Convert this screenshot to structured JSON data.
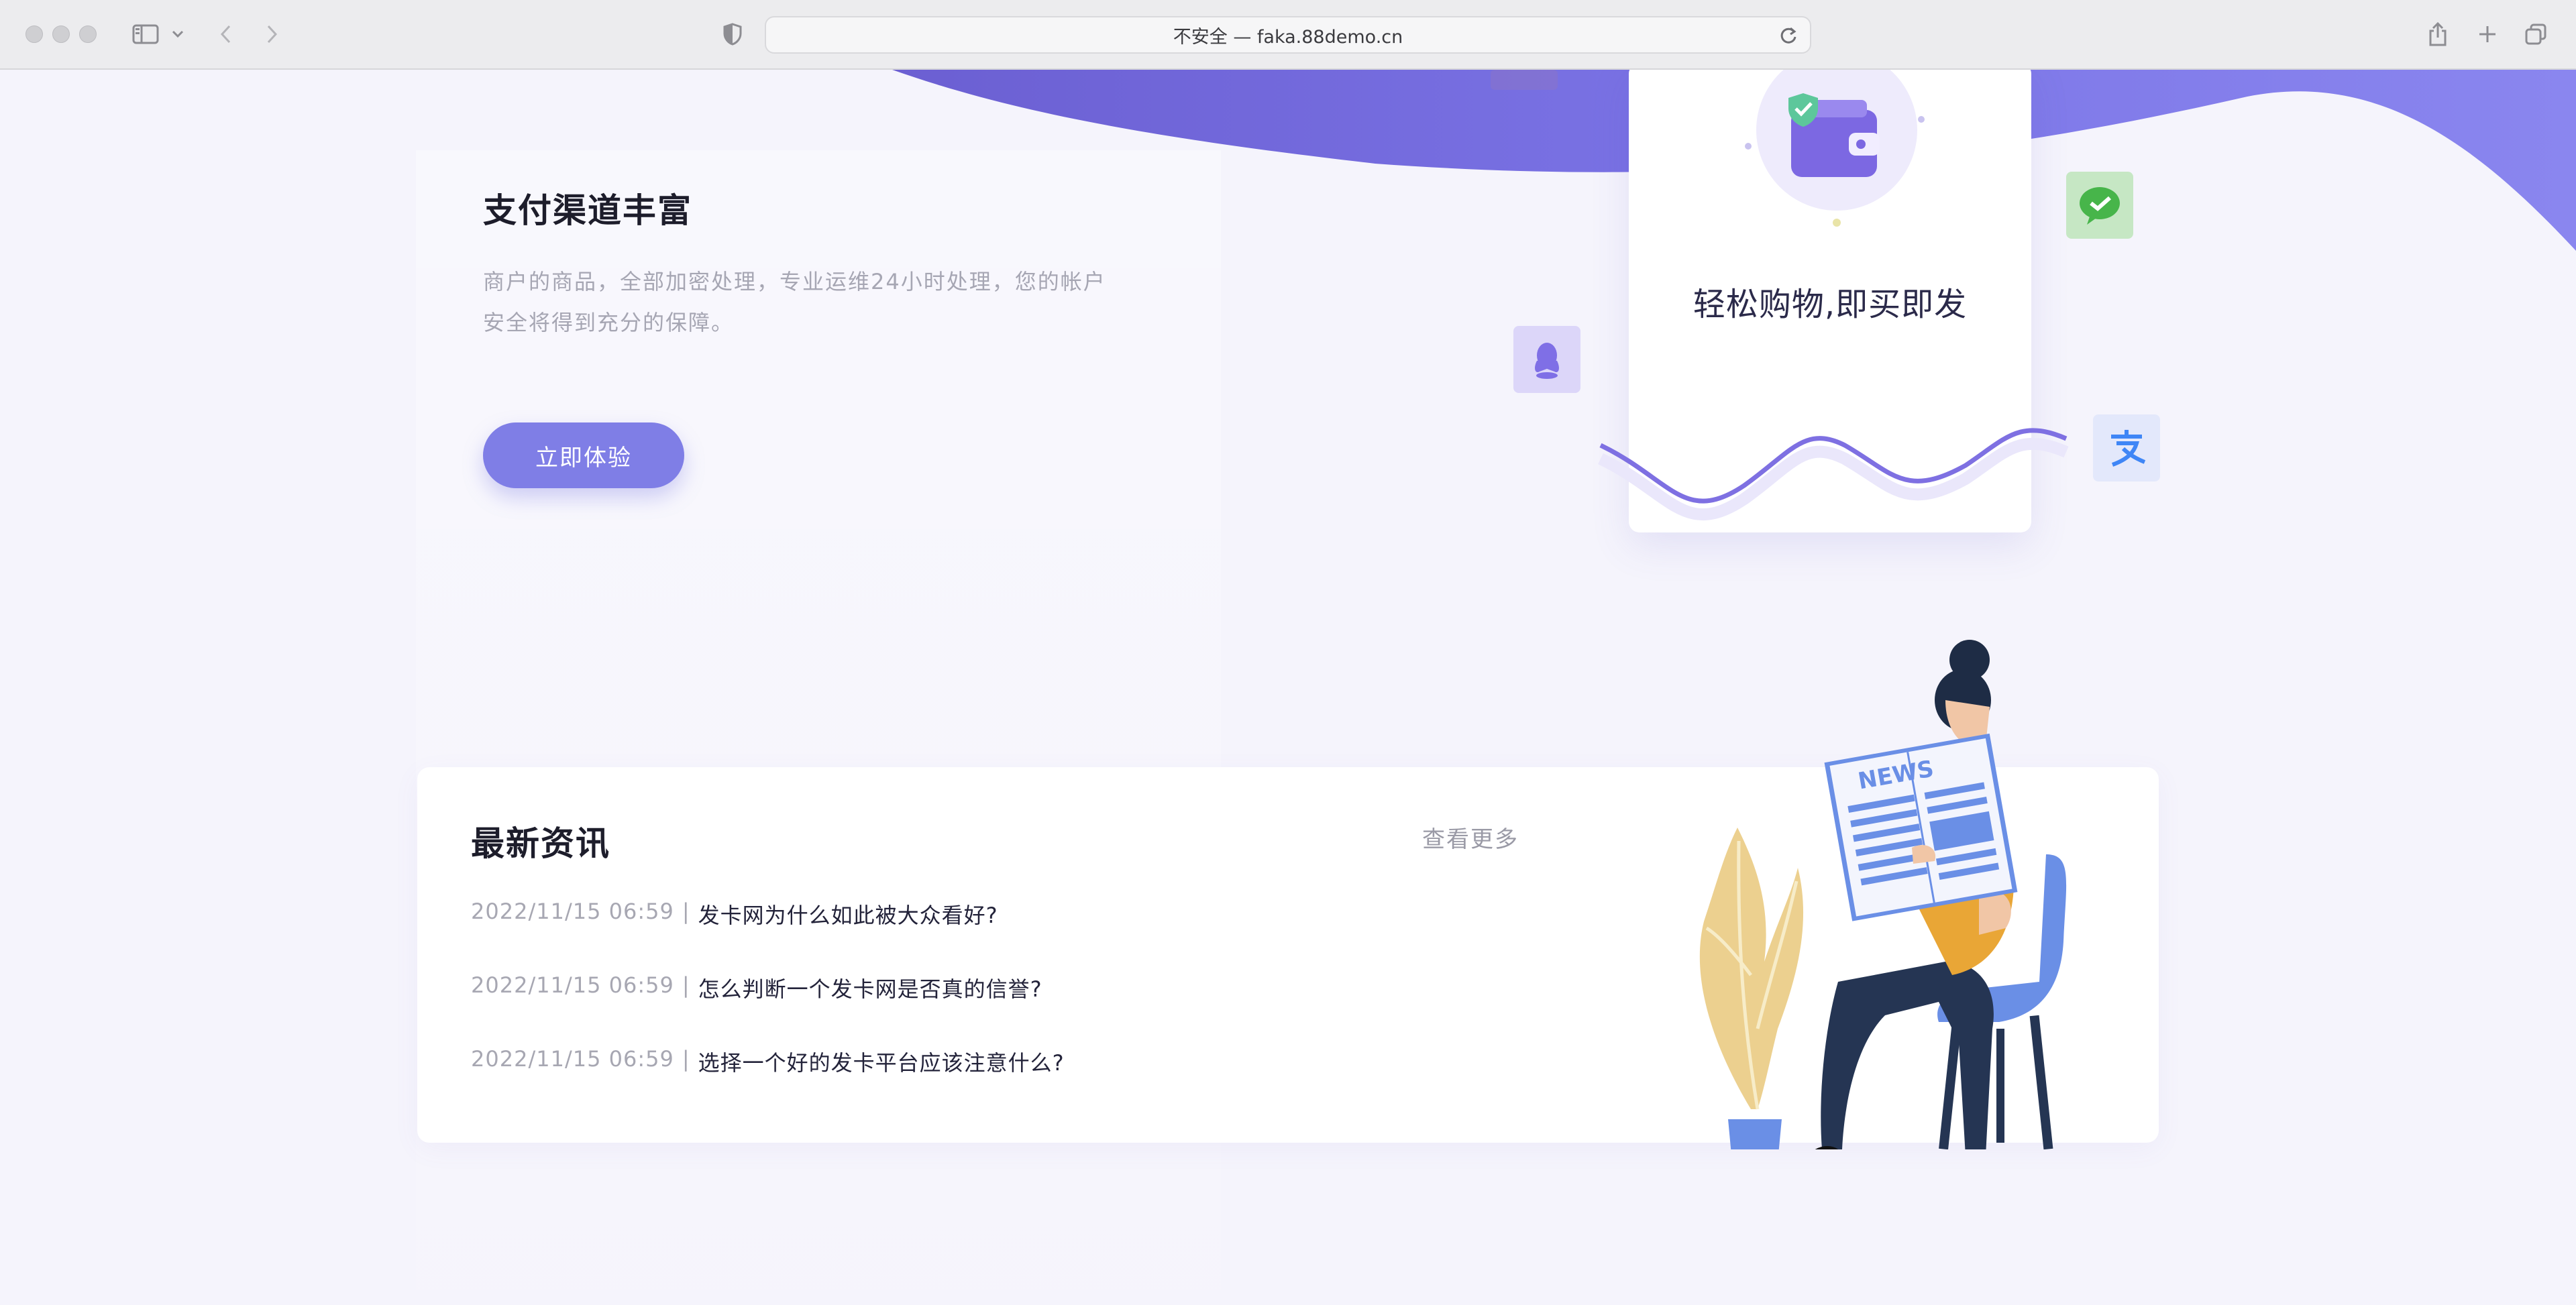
{
  "browser": {
    "address": "不安全 — faka.88demo.cn"
  },
  "hero": {
    "title": "支付渠道丰富",
    "description": "商户的商品，全部加密处理，专业运维24小时处理，您的帐户安全将得到充分的保障。",
    "cta_label": "立即体验",
    "card_caption": "轻松购物,即买即发"
  },
  "news": {
    "title": "最新资讯",
    "more_label": "查看更多",
    "separator": "|",
    "items": [
      {
        "date": "2022/11/15 06:59",
        "title": "发卡网为什么如此被大众看好?"
      },
      {
        "date": "2022/11/15 06:59",
        "title": "怎么判断一个发卡网是否真的信誉?"
      },
      {
        "date": "2022/11/15 06:59",
        "title": "选择一个好的发卡平台应该注意什么?"
      }
    ]
  },
  "illustration": {
    "newspaper_text": "NEWS"
  },
  "icons": [
    "sidebar-toggle-icon",
    "chevron-down-icon",
    "back-arrow-icon",
    "forward-arrow-icon",
    "shield-privacy-icon",
    "reload-icon",
    "share-icon",
    "new-tab-icon",
    "tabs-overview-icon",
    "wallet-icon",
    "wechat-icon",
    "qq-icon",
    "alipay-icon"
  ],
  "colors": {
    "accent": "#7f7ee6",
    "wave": "#7b6fe0",
    "wechat": "#47b54a",
    "alipay": "#3f86f6",
    "qq": "#7f6fe6"
  }
}
